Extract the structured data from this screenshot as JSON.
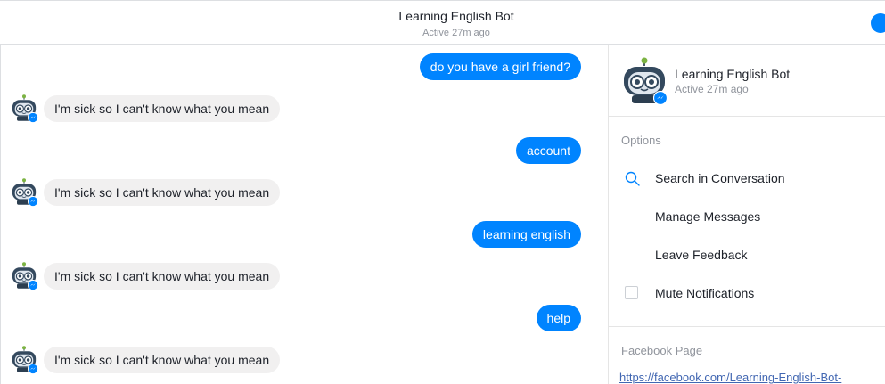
{
  "header": {
    "title": "Learning English Bot",
    "status": "Active 27m ago"
  },
  "messages": [
    {
      "from": "me",
      "text": "do you have a girl friend?"
    },
    {
      "from": "bot",
      "text": "I'm sick so I can't know what you mean"
    },
    {
      "from": "me",
      "text": "account"
    },
    {
      "from": "bot",
      "text": "I'm sick so I can't know what you mean"
    },
    {
      "from": "me",
      "text": "learning english"
    },
    {
      "from": "bot",
      "text": "I'm sick so I can't know what you mean"
    },
    {
      "from": "me",
      "text": "help"
    },
    {
      "from": "bot",
      "text": "I'm sick so I can't know what you mean"
    }
  ],
  "panel": {
    "name": "Learning English Bot",
    "status": "Active 27m ago",
    "options_title": "Options",
    "options": {
      "search": "Search in Conversation",
      "manage": "Manage Messages",
      "feedback": "Leave Feedback",
      "mute": "Mute Notifications"
    },
    "page_title": "Facebook Page",
    "page_link": "https://facebook.com/Learning-English-Bot-"
  },
  "colors": {
    "accent": "#0084ff",
    "incoming_bubble": "#f1f0f0",
    "muted_text": "#90949c"
  },
  "icons": [
    "bot-avatar-icon",
    "messenger-badge-icon",
    "search-icon",
    "checkbox-icon",
    "info-icon"
  ]
}
